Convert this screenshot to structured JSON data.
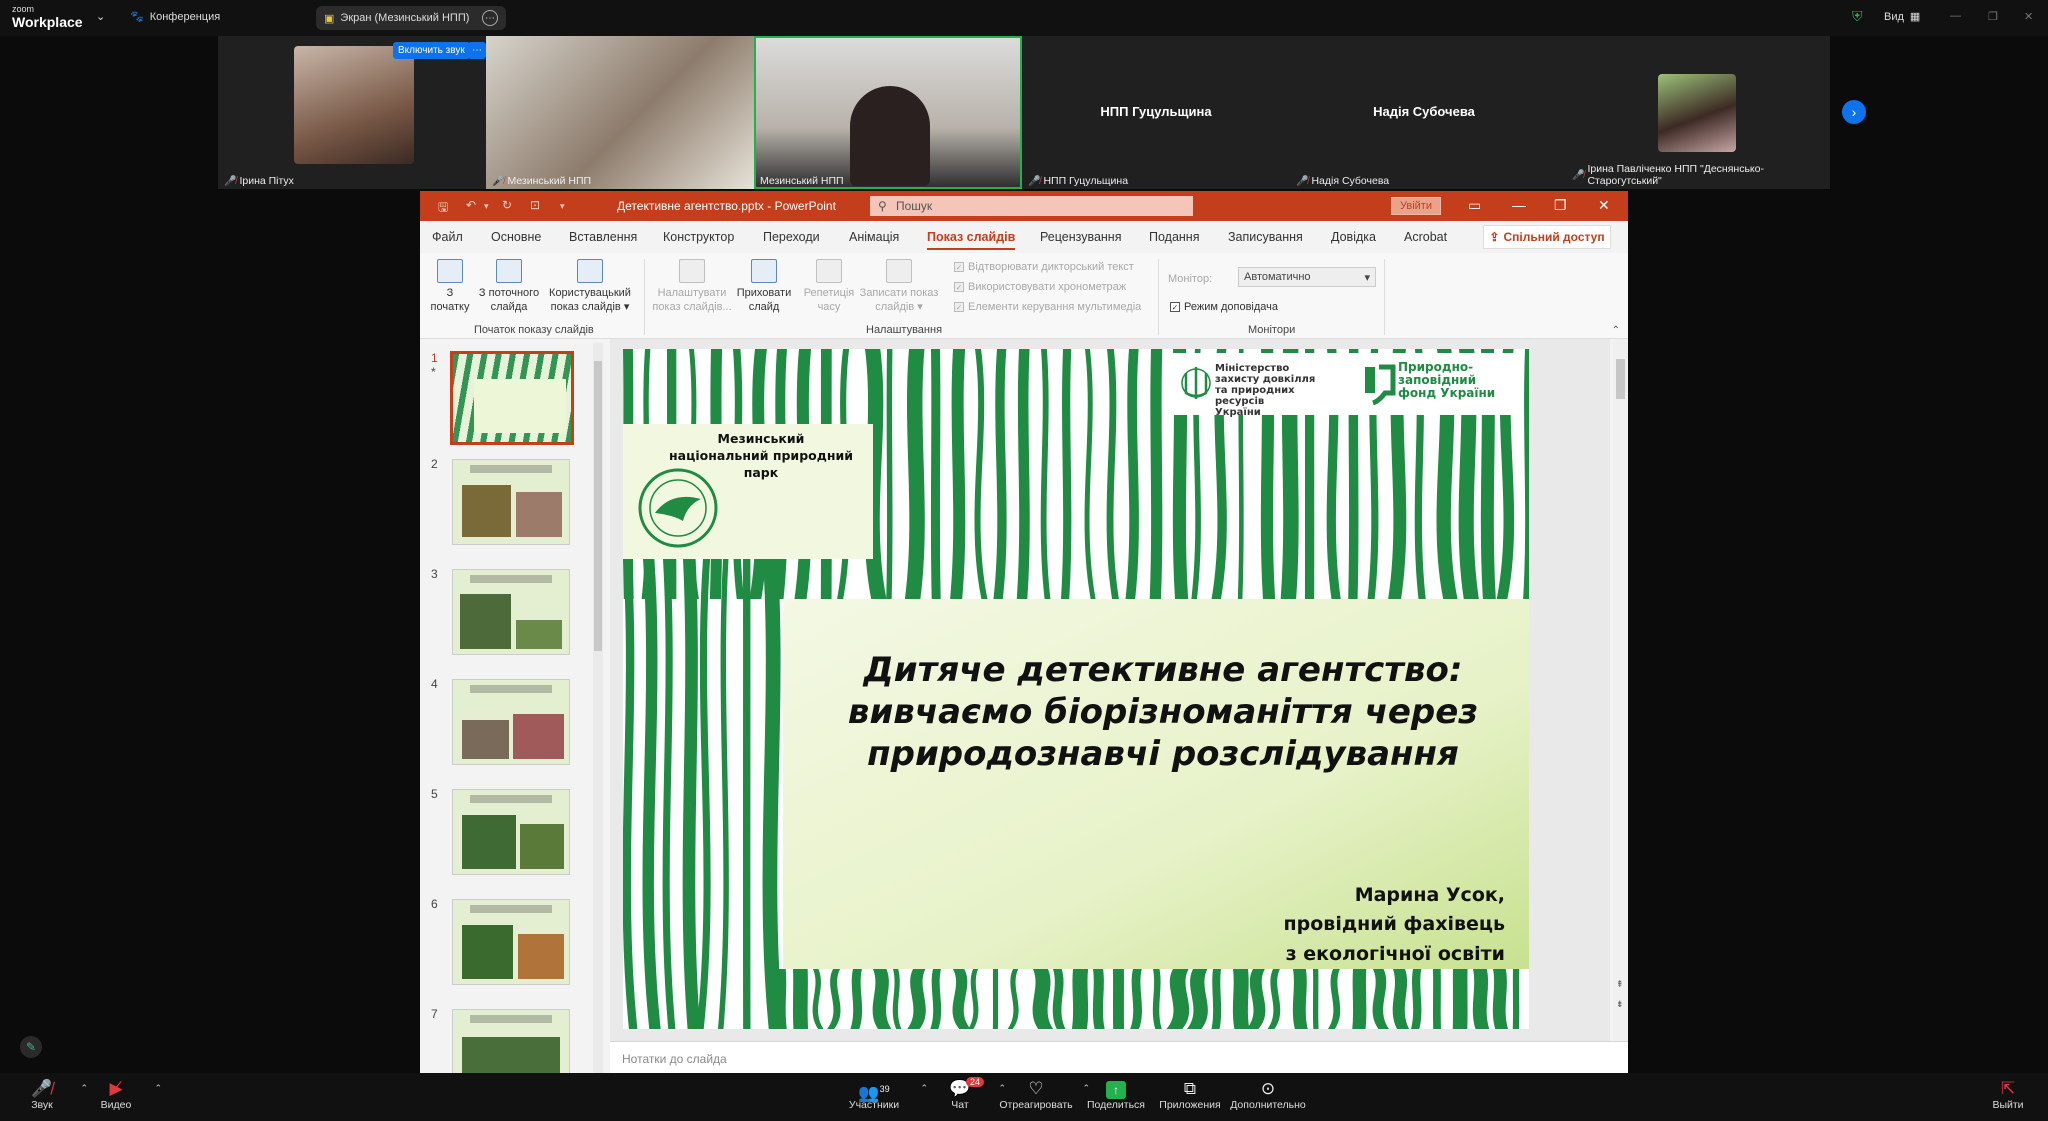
{
  "zoom": {
    "logo_small": "zoom",
    "logo_big": "Workplace",
    "conference": "Конференция",
    "screen_label": "Экран (Мезинський НПП)",
    "view_label": "Вид"
  },
  "participants": {
    "unmute_button": "Включить звук",
    "tiles": [
      {
        "name": "Ірина Пітух"
      },
      {
        "name": "Мезинський НПП"
      },
      {
        "name": "Мезинський НПП"
      },
      {
        "name": "НПП Гуцульщина",
        "center": "НПП Гуцульщина"
      },
      {
        "name": "Надія Субочева",
        "center": "Надія Субочева"
      },
      {
        "name": "Ірина Павліченко НПП \"Деснянсько-Старогутський\""
      }
    ]
  },
  "ppt": {
    "filename": "Детективне агентство.pptx  -  PowerPoint",
    "search_placeholder": "Пошук",
    "signin": "Увійти",
    "menu": [
      "Файл",
      "Основне",
      "Вставлення",
      "Конструктор",
      "Переходи",
      "Анімація",
      "Показ слайдів",
      "Рецензування",
      "Подання",
      "Записування",
      "Довідка",
      "Acrobat"
    ],
    "share": "Спільний доступ",
    "ribbon": {
      "from_start": "З\nпочатку",
      "from_current": "З поточного\nслайда",
      "custom_show": "Користувацький\nпоказ слайдів ▾",
      "group_start": "Початок показу слайдів",
      "setup": "Налаштувати\nпоказ слайдів...",
      "hide": "Приховати\nслайд",
      "rehearse": "Репетиція\nчасу",
      "record": "Записати показ\nслайдів ▾",
      "chk_narration": "Відтворювати дикторський текст",
      "chk_timings": "Використовувати хронометраж",
      "chk_media": "Елементи керування мультимедіа",
      "group_setup": "Налаштування",
      "monitor_label": "Монітор:",
      "monitor_value": "Автоматично",
      "presenter_view": "Режим доповідача",
      "group_monitors": "Монітори"
    },
    "thumb_numbers": [
      "1",
      "2",
      "3",
      "4",
      "5",
      "6",
      "7"
    ],
    "slide": {
      "park": "Мезинський\nнаціональний природний\nпарк",
      "ministry": "Міністерство\nзахисту довкілля\nта природних ресурсів\nУкраїни",
      "fund": "Природно-\nзаповідний\nфонд України",
      "title": "Дитяче детективне агентство:\nвивчаємо біорізноманіття через\nприродознавчі розслідування",
      "author": "Марина Усок,\nпровідний фахівець\nз екологічної освіти"
    },
    "notes_placeholder": "Нотатки до слайда"
  },
  "controls": {
    "audio": "Звук",
    "video": "Видео",
    "participants": "Участники",
    "participants_count": "39",
    "chat": "Чат",
    "chat_badge": "24",
    "react": "Отреагировать",
    "share": "Поделиться",
    "apps": "Приложения",
    "more": "Дополнительно",
    "leave": "Выйти"
  },
  "colors": {
    "ppt_accent": "#c43e1c",
    "zoom_blue": "#0e72ed",
    "slide_green": "#1f8b43"
  }
}
